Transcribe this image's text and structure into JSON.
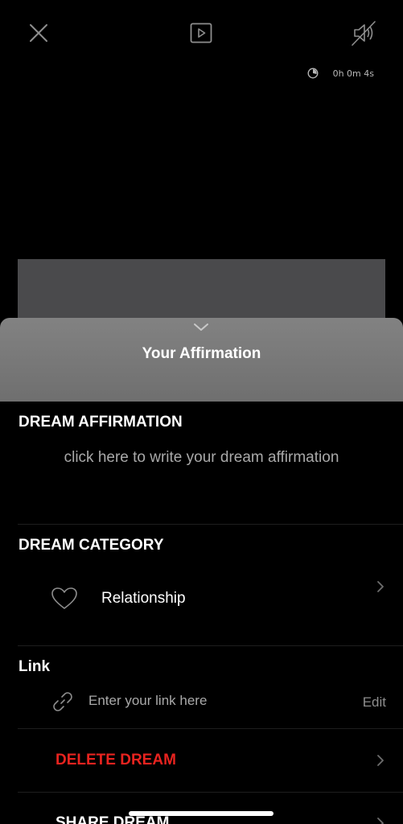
{
  "timer": {
    "icon": "timer-icon",
    "label": "0h 0m 4s"
  },
  "toolbar": {
    "close_icon": "close-icon",
    "play_icon": "play-icon",
    "mute_icon": "speaker-muted-icon"
  },
  "sheet": {
    "title": "Your Affirmation",
    "collapse_icon": "chevron-down-icon"
  },
  "affirmation": {
    "section_title": "DREAM AFFIRMATION",
    "placeholder": "click here to write your dream affirmation"
  },
  "category": {
    "section_title": "DREAM CATEGORY",
    "icon": "heart-icon",
    "value": "Relationship"
  },
  "link": {
    "section_title": "Link",
    "icon": "link-icon",
    "placeholder": "Enter your link here",
    "edit_label": "Edit"
  },
  "actions": {
    "delete_label": "DELETE DREAM",
    "share_label": "SHARE DREAM"
  },
  "colors": {
    "background": "#000000",
    "danger": "#e8231f",
    "muted_text": "#a9a9a9",
    "sheet_header": "#7a7a7a"
  }
}
